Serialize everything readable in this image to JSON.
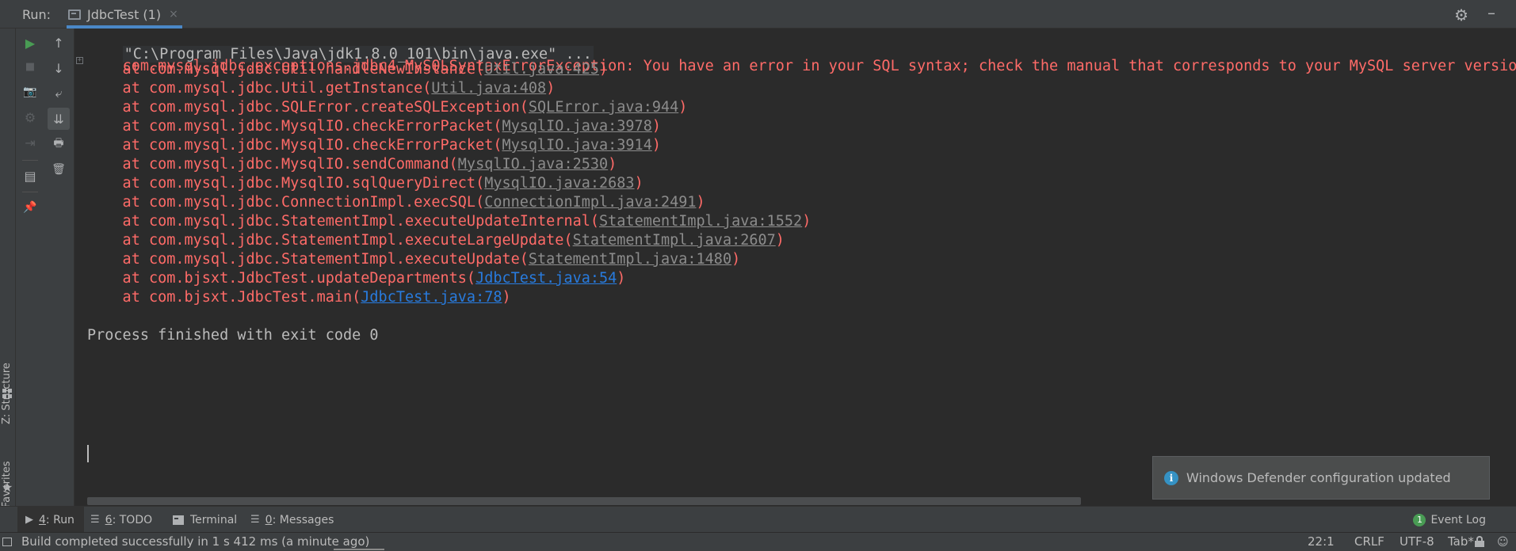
{
  "header": {
    "run_label": "Run:",
    "tab_title": "JdbcTest (1)",
    "tab_close": "×",
    "settings_icon": "⚙",
    "minimize_icon": "–"
  },
  "left_strip": {
    "structure_label": "Z: Structure",
    "favorites_label": "2: Favorites",
    "star": "★"
  },
  "toolbar": {
    "rerun": "▶",
    "stop": "■",
    "dump_threads": "📷",
    "debug_settings": "⚙",
    "exit": "⇥",
    "layout": "▤",
    "pin": "📌",
    "up": "↑",
    "down": "↓",
    "soft_wrap": "⤶",
    "scroll_to_end": "⇊",
    "print": "🖶",
    "clear": "🗑"
  },
  "console": {
    "command": "\"C:\\Program Files\\Java\\jdk1.8.0_101\\bin\\java.exe\" ...",
    "exception": "com.mysql.jdbc.exceptions.jdbc4.MySQLSyntaxErrorException: You have an error in your SQL syntax; check the manual that corresponds to your MySQL server version for",
    "fold_marker": "+",
    "stack": [
      {
        "method": "    at com.mysql.jdbc.Util.handleNewInstance(",
        "link": "Util.java:425",
        "close": ")"
      },
      {
        "method": "    at com.mysql.jdbc.Util.getInstance(",
        "link": "Util.java:408",
        "close": ")"
      },
      {
        "method": "    at com.mysql.jdbc.SQLError.createSQLException(",
        "link": "SQLError.java:944",
        "close": ")"
      },
      {
        "method": "    at com.mysql.jdbc.MysqlIO.checkErrorPacket(",
        "link": "MysqlIO.java:3978",
        "close": ")"
      },
      {
        "method": "    at com.mysql.jdbc.MysqlIO.checkErrorPacket(",
        "link": "MysqlIO.java:3914",
        "close": ")"
      },
      {
        "method": "    at com.mysql.jdbc.MysqlIO.sendCommand(",
        "link": "MysqlIO.java:2530",
        "close": ")"
      },
      {
        "method": "    at com.mysql.jdbc.MysqlIO.sqlQueryDirect(",
        "link": "MysqlIO.java:2683",
        "close": ")"
      },
      {
        "method": "    at com.mysql.jdbc.ConnectionImpl.execSQL(",
        "link": "ConnectionImpl.java:2491",
        "close": ")"
      },
      {
        "method": "    at com.mysql.jdbc.StatementImpl.executeUpdateInternal(",
        "link": "StatementImpl.java:1552",
        "close": ")"
      },
      {
        "method": "    at com.mysql.jdbc.StatementImpl.executeLargeUpdate(",
        "link": "StatementImpl.java:2607",
        "close": ")"
      },
      {
        "method": "    at com.mysql.jdbc.StatementImpl.executeUpdate(",
        "link": "StatementImpl.java:1480",
        "close": ")"
      },
      {
        "method": "    at com.bjsxt.JdbcTest.updateDepartments(",
        "link": "JdbcTest.java:54",
        "close": ")"
      },
      {
        "method": "    at com.bjsxt.JdbcTest.main(",
        "link": "JdbcTest.java:78",
        "close": ")"
      }
    ],
    "exit_message": "Process finished with exit code 0"
  },
  "notification": {
    "icon": "i",
    "text": "Windows Defender configuration updated"
  },
  "bottom_tabs": {
    "run": {
      "icon": "▶",
      "mnemonic": "4",
      "label": ": Run"
    },
    "todo": {
      "icon": "☰",
      "mnemonic": "6",
      "label": ": TODO"
    },
    "terminal": {
      "label": "Terminal"
    },
    "messages": {
      "icon": "☰",
      "mnemonic": "0",
      "label": ": Messages"
    },
    "event_log": {
      "badge": "1",
      "label": "Event Log"
    }
  },
  "status_bar": {
    "message": "Build completed successfully in 1 s 412 ms (a minute ago)",
    "position": "22:1",
    "line_separator": "CRLF",
    "encoding": "UTF-8",
    "indent": "Tab*",
    "inspector_icon": "☺"
  },
  "colors": {
    "background": "#2b2b2b",
    "panel": "#3c3f41",
    "error_text": "#ff6b68",
    "project_link": "#287bde",
    "library_link": "#8c8c8c",
    "run_green": "#499c54",
    "tab_underline": "#4a88c7"
  }
}
